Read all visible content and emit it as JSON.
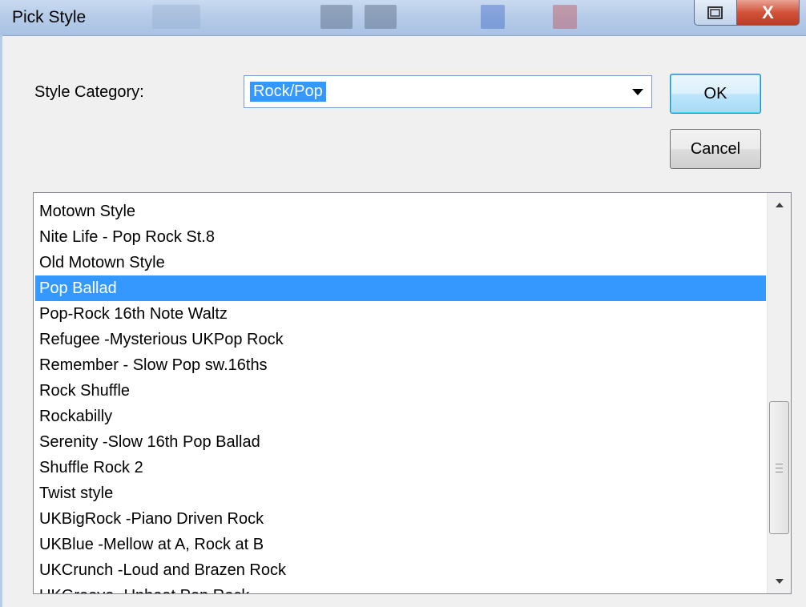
{
  "window": {
    "title": "Pick Style",
    "restore_icon": "restore-window-icon",
    "close_label": "X"
  },
  "category": {
    "label": "Style Category:",
    "value": "Rock/Pop"
  },
  "buttons": {
    "ok": "OK",
    "cancel": "Cancel"
  },
  "styles": {
    "items": [
      "Motown Style",
      "Nite Life - Pop Rock St.8",
      "Old Motown Style",
      "Pop Ballad",
      "Pop-Rock 16th Note Waltz",
      "Refugee -Mysterious UKPop Rock",
      "Remember - Slow Pop sw.16ths",
      "Rock Shuffle",
      "Rockabilly",
      "Serenity -Slow 16th Pop Ballad",
      "Shuffle Rock 2",
      "Twist style",
      "UKBigRock -Piano Driven Rock",
      "UKBlue -Mellow at A, Rock at B",
      "UKCrunch -Loud and Brazen Rock",
      "UKGroove -Upbeat Pop Rock"
    ],
    "selected_index": 3
  },
  "colors": {
    "selection": "#3399ff",
    "titlebar": "#b5cbe8",
    "close_button": "#c03a22"
  }
}
